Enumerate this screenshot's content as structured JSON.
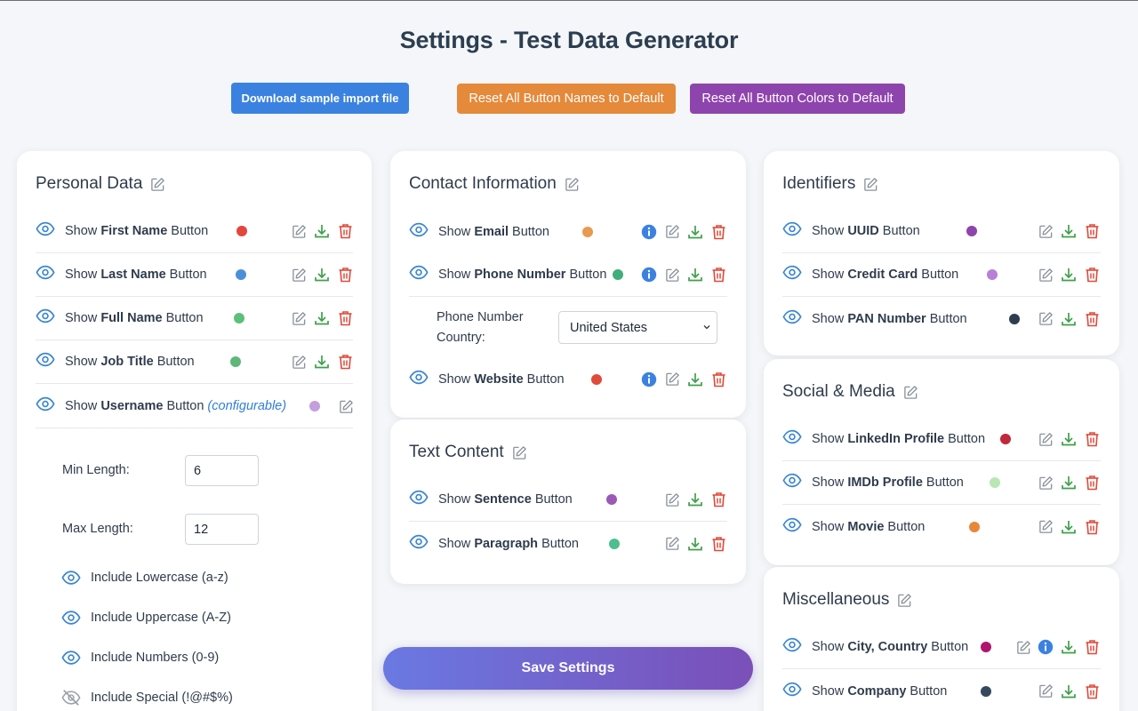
{
  "page_title": "Settings - Test Data Generator",
  "top_buttons": {
    "download": "Download sample import file",
    "reset_names": "Reset All Button Names to Default",
    "reset_colors": "Reset All Button Colors to Default"
  },
  "colors": {
    "blue": "#3b82e0",
    "orange": "#e5893a",
    "purple": "#8e44ad",
    "edit_icon": "#8a929c",
    "download_icon": "#3fa04a",
    "delete_icon": "#e04a3a",
    "eye_icon": "#3a86d0"
  },
  "personal": {
    "title": "Personal Data",
    "rows": [
      {
        "prefix": "Show ",
        "bold": "First Name",
        "suffix": " Button",
        "dot": "#e2463d"
      },
      {
        "prefix": "Show ",
        "bold": "Last Name",
        "suffix": " Button",
        "dot": "#4a90d9"
      },
      {
        "prefix": "Show ",
        "bold": "Full Name",
        "suffix": " Button",
        "dot": "#5cbf7a"
      },
      {
        "prefix": "Show ",
        "bold": "Job Title",
        "suffix": " Button",
        "dot": "#5fb77a"
      },
      {
        "prefix": "Show ",
        "bold": "Username",
        "suffix": " Button ",
        "extra": "(configurable)",
        "dot": "#c39fdc"
      }
    ],
    "min_length_label": "Min Length:",
    "min_length_value": "6",
    "max_length_label": "Max Length:",
    "max_length_value": "12",
    "options": [
      "Include Lowercase (a-z)",
      "Include Uppercase (A-Z)",
      "Include Numbers (0-9)",
      "Include Special (!@#$%)"
    ]
  },
  "contact": {
    "title": "Contact Information",
    "rows": [
      {
        "prefix": "Show ",
        "bold": "Email",
        "suffix": " Button",
        "dot": "#e89a4f"
      },
      {
        "prefix": "Show ",
        "bold": "Phone Number",
        "suffix": " Button",
        "dot": "#3fae7a"
      },
      {
        "prefix": "Show ",
        "bold": "Website",
        "suffix": " Button",
        "dot": "#e04a3a"
      }
    ],
    "country_label_1": "Phone Number",
    "country_label_2": "Country:",
    "country_value": "United States"
  },
  "text": {
    "title": "Text Content",
    "rows": [
      {
        "prefix": "Show ",
        "bold": "Sentence",
        "suffix": " Button",
        "dot": "#9b59b6"
      },
      {
        "prefix": "Show ",
        "bold": "Paragraph",
        "suffix": " Button",
        "dot": "#4cbf8e"
      }
    ]
  },
  "identifiers": {
    "title": "Identifiers",
    "rows": [
      {
        "prefix": "Show ",
        "bold": "UUID",
        "suffix": " Button",
        "dot": "#8e44ad"
      },
      {
        "prefix": "Show ",
        "bold": "Credit Card",
        "suffix": " Button",
        "dot": "#b77fd6"
      },
      {
        "prefix": "Show ",
        "bold": "PAN Number",
        "suffix": " Button",
        "dot": "#2c3e50"
      }
    ]
  },
  "social": {
    "title": "Social & Media",
    "rows": [
      {
        "prefix": "Show ",
        "bold": "LinkedIn Profile",
        "suffix": " Button",
        "dot": "#c0283b"
      },
      {
        "prefix": "Show ",
        "bold": "IMDb Profile",
        "suffix": " Button",
        "dot": "#b9e6b5"
      },
      {
        "prefix": "Show ",
        "bold": "Movie",
        "suffix": " Button",
        "dot": "#e8873a"
      }
    ]
  },
  "misc": {
    "title": "Miscellaneous",
    "rows": [
      {
        "prefix": "Show ",
        "bold": "City, Country",
        "suffix": " Button",
        "dot": "#b0146e"
      },
      {
        "prefix": "Show ",
        "bold": "Company",
        "suffix": " Button",
        "dot": "#34495e"
      }
    ]
  },
  "save_label": "Save Settings"
}
